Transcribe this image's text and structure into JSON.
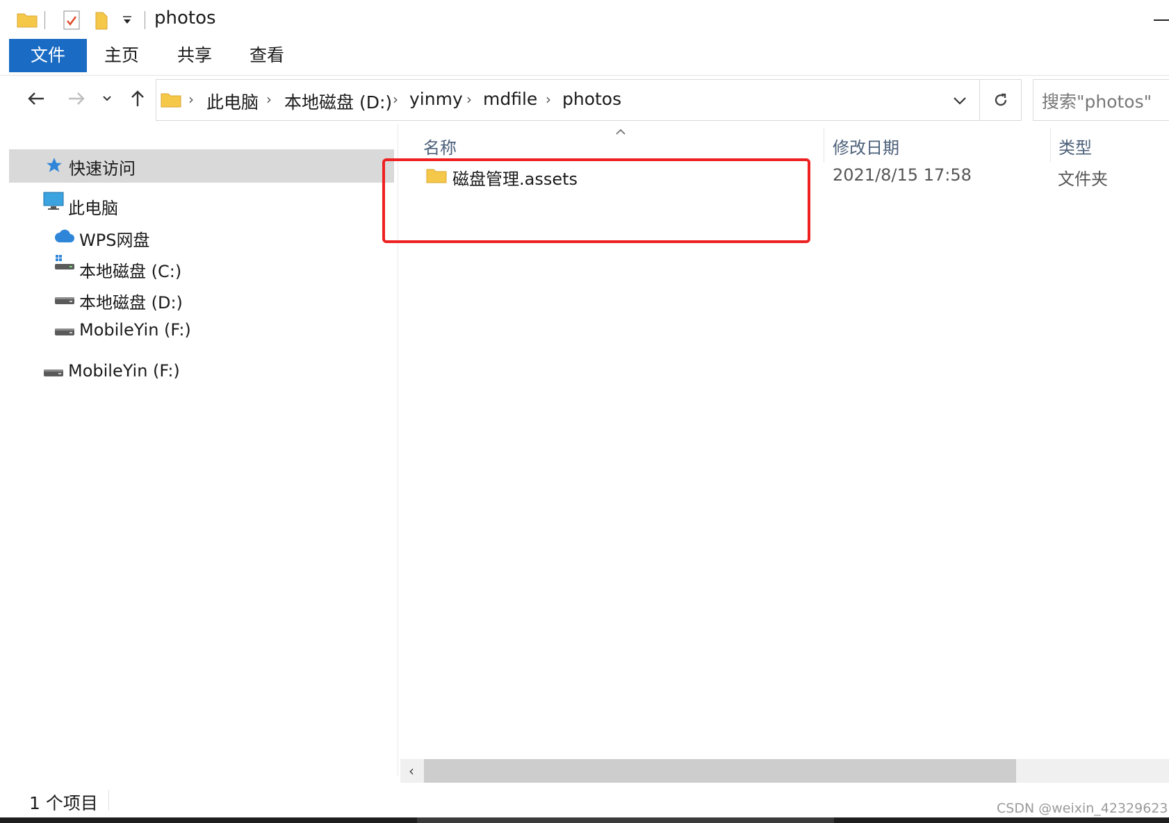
{
  "window": {
    "title": "photos"
  },
  "ribbon": {
    "tabs": [
      "文件",
      "主页",
      "共享",
      "查看"
    ]
  },
  "address": {
    "crumbs": [
      "此电脑",
      "本地磁盘 (D:)",
      "yinmy",
      "mdfile",
      "photos"
    ],
    "search_placeholder": "搜索\"photos\""
  },
  "nav": {
    "quick_access": "快速访问",
    "this_pc": "此电脑",
    "wps_drive": "WPS网盘",
    "drive_c": "本地磁盘 (C:)",
    "drive_d": "本地磁盘 (D:)",
    "drive_f_child": "MobileYin (F:)",
    "drive_f_root": "MobileYin (F:)"
  },
  "columns": {
    "name": "名称",
    "date": "修改日期",
    "type": "类型"
  },
  "files": [
    {
      "name": "磁盘管理.assets",
      "modified": "2021/8/15 17:58",
      "type": "文件夹"
    }
  ],
  "status": {
    "item_count": "1 个项目"
  },
  "watermark": "CSDN @weixin_42329623",
  "colors": {
    "accent": "#1a6bc4",
    "highlight": "#ee2020",
    "folder": "#f5c84a"
  }
}
